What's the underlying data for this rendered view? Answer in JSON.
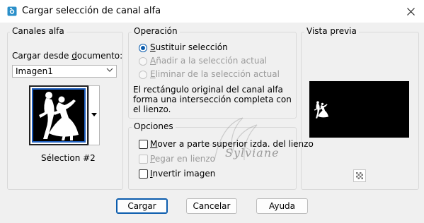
{
  "window": {
    "title": "Cargar selección de canal alfa",
    "app_icon": "camera-icon",
    "close_icon": "close-icon"
  },
  "channels": {
    "group_title": "Canales alfa",
    "load_from_label": "Cargar desde documento:",
    "document_value": "Imagen1",
    "thumbnail_caption": "Sélection #2"
  },
  "operation": {
    "group_title": "Operación",
    "options": [
      {
        "label": "Sustituir selección",
        "selected": true,
        "enabled": true
      },
      {
        "label": "Añadir a la selección actual",
        "selected": false,
        "enabled": false
      },
      {
        "label": "Eliminar de la selección actual",
        "selected": false,
        "enabled": false
      }
    ],
    "description": [
      "El rectángulo original del canal alfa",
      "forma una intersección completa con",
      "el lienzo."
    ]
  },
  "options": {
    "group_title": "Opciones",
    "checkboxes": [
      {
        "label": "Mover a parte superior izda. del lienzo",
        "checked": false,
        "enabled": true
      },
      {
        "label": "Pegar en lienzo",
        "checked": false,
        "enabled": false
      },
      {
        "label": "Invertir imagen",
        "checked": false,
        "enabled": true
      }
    ]
  },
  "preview": {
    "group_title": "Vista previa",
    "zoom_icon": "checkerboard-icon"
  },
  "buttons": {
    "load": "Cargar",
    "cancel": "Cancelar",
    "help": "Ayuda"
  },
  "watermark": {
    "text": "Sylviane"
  },
  "colors": {
    "accent": "#0b5cad",
    "disabled_text": "#9a9a9a",
    "background": "#f0f0f0"
  }
}
